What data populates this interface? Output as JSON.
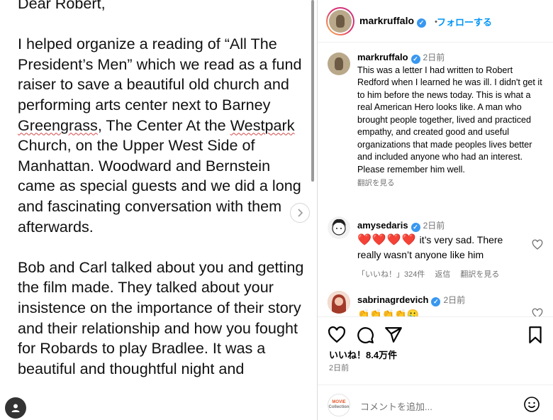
{
  "letter": {
    "greeting": "Dear Robert,",
    "p1": [
      "I helped organize a reading of “All The President’s Men” which we read as a fund raiser to save a beautiful old church and performing arts center next to Barney ",
      "Greengrass",
      ", The Center At the ",
      "Westpark",
      " Church, on the Upper West Side of Manhattan. Woodward and Bernstein came as special guests and we did a long and fascinating conversation with them afterwards."
    ],
    "p2": "Bob and Carl talked about you and getting the film made. They talked about your insistence on the importance of their story and their relationship and how you fought for Robards to play Bradlee. It was a beautiful and thoughtful night and"
  },
  "header": {
    "username": "markruffalo",
    "dot": "・",
    "follow_label": "フォローする"
  },
  "caption": {
    "username": "markruffalo",
    "time": "2日前",
    "text": "This was a letter I had written to Robert Redford when I learned he was ill. I didn't get it to him before the news today. This is what a real American Hero looks like. A man who brought people together, lived and practiced empathy, and created good and useful organizations that made peoples lives better and included anyone who had an interest. Please remember him well.",
    "translate": "翻訳を見る"
  },
  "comments": [
    {
      "username": "amysedaris",
      "time": "2日前",
      "hearts": "❤️❤️❤️❤️",
      "text": " it’s very sad. There really wasn’t anyone like him",
      "likes": "「いいね！」324件",
      "reply": "返信",
      "translate": "翻訳を見る"
    },
    {
      "username": "sabrinagrdevich",
      "time": "2日前",
      "emoji": "👏👏👏👏🥲"
    }
  ],
  "actions": {
    "likes_label": "いいね！8.4万件",
    "date": "2日前"
  },
  "comment_bar": {
    "logo_text_1": "MOVIE",
    "logo_text_2": "Collection",
    "placeholder": "コメントを追加..."
  },
  "colors": {
    "accent": "#0095f6",
    "verified": "#3897f0",
    "heart": "#e0245e",
    "muted": "#737373"
  },
  "icons": [
    "chevron-right-icon",
    "person-icon",
    "verified-icon",
    "heart-outline-icon",
    "comment-icon",
    "share-icon",
    "bookmark-icon",
    "emoji-icon"
  ]
}
